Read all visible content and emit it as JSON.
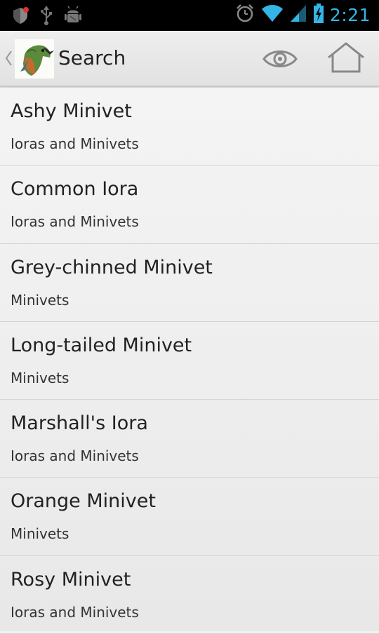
{
  "status_bar": {
    "time": "2:21",
    "icons": [
      "shield-notification-icon",
      "usb-icon",
      "android-debug-icon",
      "alarm-icon",
      "wifi-icon",
      "signal-icon",
      "battery-charging-icon"
    ]
  },
  "action_bar": {
    "title": "Search",
    "actions": [
      "eye-icon",
      "home-icon"
    ]
  },
  "results": [
    {
      "name": "Ashy Minivet",
      "group": "Ioras and Minivets"
    },
    {
      "name": "Common Iora",
      "group": "Ioras and Minivets"
    },
    {
      "name": "Grey-chinned Minivet",
      "group": "Minivets"
    },
    {
      "name": "Long-tailed Minivet",
      "group": "Minivets"
    },
    {
      "name": "Marshall's Iora",
      "group": "Ioras and Minivets"
    },
    {
      "name": "Orange Minivet",
      "group": "Minivets"
    },
    {
      "name": "Rosy Minivet",
      "group": "Ioras and Minivets"
    }
  ],
  "colors": {
    "status_accent": "#33b5e5",
    "action_bar": "#e8e8e8",
    "list_bg": "#f0f0f0",
    "divider": "#d4d4d4"
  }
}
